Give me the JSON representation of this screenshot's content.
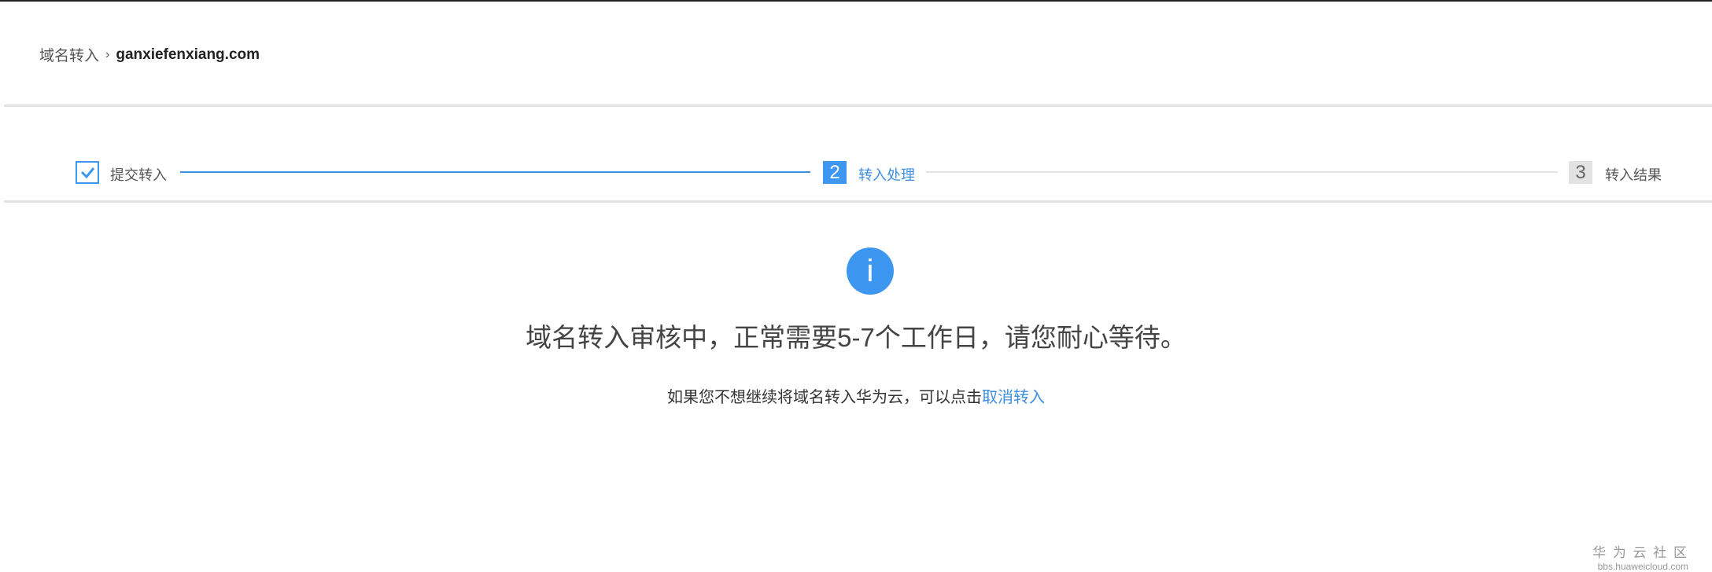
{
  "breadcrumb": {
    "parent": "域名转入",
    "separator": "›",
    "current": "ganxiefenxiang.com"
  },
  "steps": [
    {
      "index": "1",
      "label": "提交转入",
      "status": "done"
    },
    {
      "index": "2",
      "label": "转入处理",
      "status": "active"
    },
    {
      "index": "3",
      "label": "转入结果",
      "status": "pending"
    }
  ],
  "status": {
    "icon": "i",
    "headline": "域名转入审核中，正常需要5-7个工作日，请您耐心等待。",
    "hint": "如果您不想继续将域名转入华为云，可以点击",
    "cancel_link": "取消转入"
  },
  "watermark": {
    "title": "华 为 云 社 区",
    "url": "bbs.huaweicloud.com"
  },
  "colors": {
    "accent": "#3d96f0",
    "pending": "#e3e3e3"
  }
}
